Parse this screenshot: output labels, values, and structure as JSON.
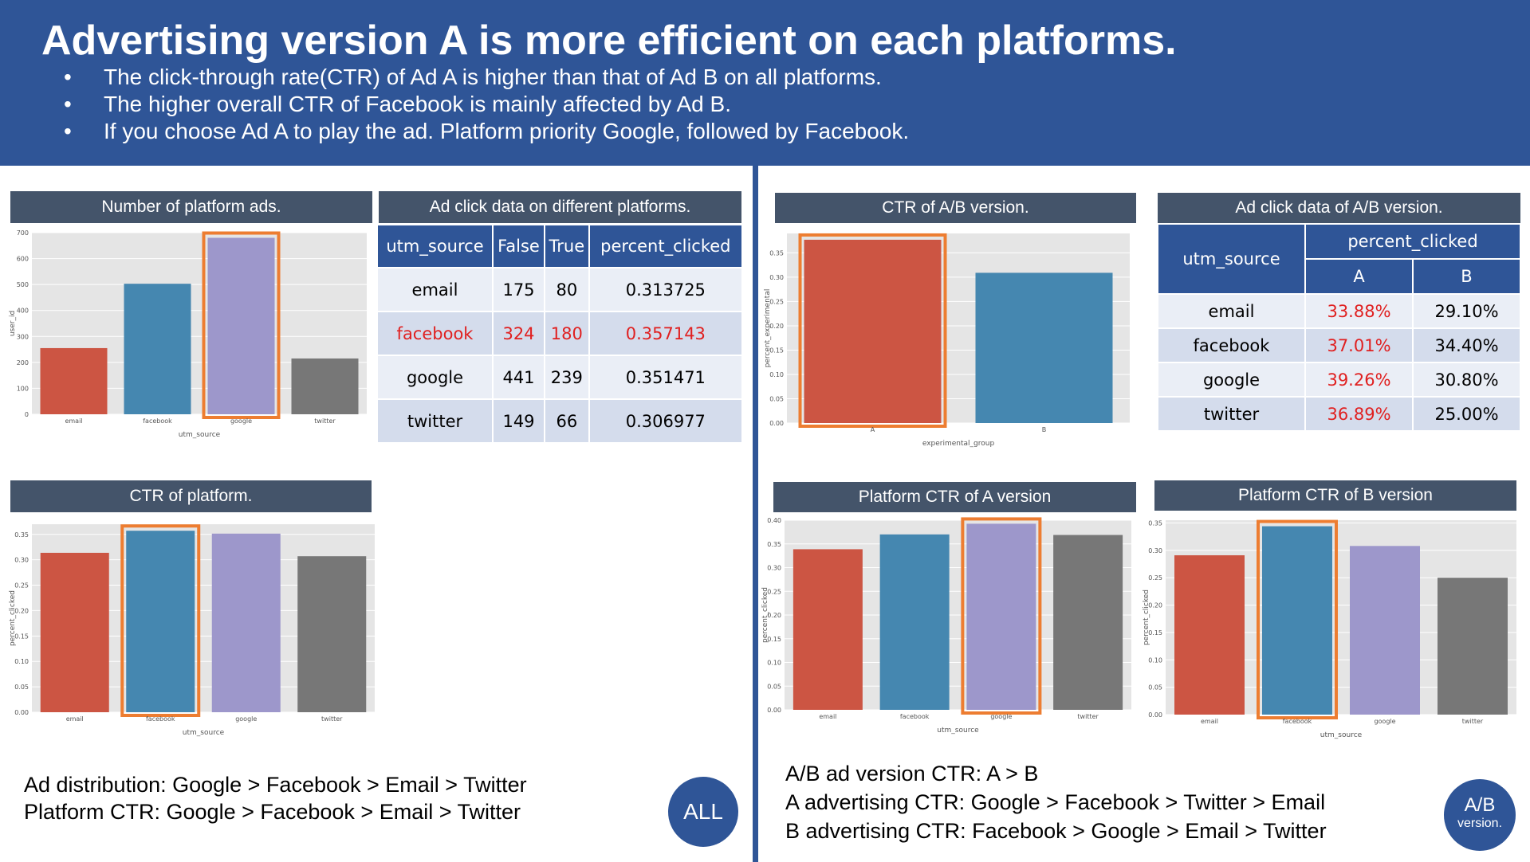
{
  "header": {
    "title": "Advertising version A is more efficient on each platforms.",
    "bullets": [
      "The click-through rate(CTR) of Ad A is higher than that of Ad B on all platforms.",
      "The higher overall CTR of Facebook is mainly affected by Ad B.",
      "If you choose Ad A to play the ad. Platform priority Google, followed by Facebook."
    ],
    "bullet_glyph": "•",
    "bg_color": "#2f5597"
  },
  "panels": {
    "platform_ads_title": "Number of platform ads.",
    "click_data_title": "Ad click data on different platforms.",
    "ctr_platform_title": "CTR of platform.",
    "ctr_ab_title": "CTR of A/B version.",
    "ab_click_title": "Ad click data of A/B version.",
    "platform_a_title": "Platform CTR of A version",
    "platform_b_title": "Platform CTR of B version"
  },
  "table_platform": {
    "headers": [
      "utm_source",
      "False",
      "True",
      "percent_clicked"
    ],
    "rows": [
      {
        "source": "email",
        "false": "175",
        "true": "80",
        "pct": "0.313725",
        "highlight": false
      },
      {
        "source": "facebook",
        "false": "324",
        "true": "180",
        "pct": "0.357143",
        "highlight": true
      },
      {
        "source": "google",
        "false": "441",
        "true": "239",
        "pct": "0.351471",
        "highlight": false
      },
      {
        "source": "twitter",
        "false": "149",
        "true": "66",
        "pct": "0.306977",
        "highlight": false
      }
    ]
  },
  "table_ab": {
    "header_source": "utm_source",
    "header_pct": "percent_clicked",
    "header_a": "A",
    "header_b": "B",
    "rows": [
      {
        "source": "email",
        "a": "33.88%",
        "b": "29.10%"
      },
      {
        "source": "facebook",
        "a": "37.01%",
        "b": "34.40%"
      },
      {
        "source": "google",
        "a": "39.26%",
        "b": "30.80%"
      },
      {
        "source": "twitter",
        "a": "36.89%",
        "b": "25.00%"
      }
    ]
  },
  "notes": {
    "left_line1": "Ad distribution: Google > Facebook > Email > Twitter",
    "left_line2": "Platform CTR: Google > Facebook > Email > Twitter",
    "right_line1": "A/B ad version CTR: A > B",
    "right_line2": "A advertising CTR: Google > Facebook > Twitter > Email",
    "right_line3": "B advertising CTR: Facebook > Google > Email > Twitter"
  },
  "badges": {
    "all": "ALL",
    "ab_top": "A/B",
    "ab_bottom": "version."
  },
  "colors": {
    "email": "#cc5543",
    "facebook": "#4587b0",
    "google": "#9d97cb",
    "twitter": "#777777",
    "highlight_box": "#ed7d31",
    "plot_bg": "#e5e5e5",
    "title_bar": "#44546a",
    "table_header": "#2f5597",
    "red_text": "#e02020"
  },
  "chart_data": [
    {
      "id": "platform_ads",
      "type": "bar",
      "categories": [
        "email",
        "facebook",
        "google",
        "twitter"
      ],
      "values": [
        255,
        503,
        680,
        215
      ],
      "xlabel": "utm_source",
      "ylabel": "user_id",
      "ylim": [
        0,
        700
      ],
      "yticks": [
        0,
        100,
        200,
        300,
        400,
        500,
        600,
        700
      ],
      "highlight": "google",
      "grid": true
    },
    {
      "id": "ctr_platform",
      "type": "bar",
      "categories": [
        "email",
        "facebook",
        "google",
        "twitter"
      ],
      "values": [
        0.313725,
        0.357143,
        0.351471,
        0.306977
      ],
      "xlabel": "utm_source",
      "ylabel": "percent_clicked",
      "ylim": [
        0,
        0.37
      ],
      "yticks": [
        0.0,
        0.05,
        0.1,
        0.15,
        0.2,
        0.25,
        0.3,
        0.35
      ],
      "highlight": "facebook",
      "grid": true
    },
    {
      "id": "ctr_ab",
      "type": "bar",
      "categories": [
        "A",
        "B"
      ],
      "values": [
        0.377,
        0.309
      ],
      "xlabel": "experimental_group",
      "ylabel": "percent_experimental",
      "ylim": [
        0,
        0.39
      ],
      "yticks": [
        0.0,
        0.05,
        0.1,
        0.15,
        0.2,
        0.25,
        0.3,
        0.35
      ],
      "highlight": "A",
      "grid": true
    },
    {
      "id": "platform_a",
      "type": "bar",
      "categories": [
        "email",
        "facebook",
        "google",
        "twitter"
      ],
      "values": [
        0.3388,
        0.3701,
        0.3926,
        0.3689
      ],
      "xlabel": "utm_source",
      "ylabel": "percent_clicked",
      "ylim": [
        0,
        0.4
      ],
      "yticks": [
        0.0,
        0.05,
        0.1,
        0.15,
        0.2,
        0.25,
        0.3,
        0.35,
        0.4
      ],
      "highlight": "google",
      "grid": true
    },
    {
      "id": "platform_b",
      "type": "bar",
      "categories": [
        "email",
        "facebook",
        "google",
        "twitter"
      ],
      "values": [
        0.291,
        0.344,
        0.308,
        0.25
      ],
      "xlabel": "utm_source",
      "ylabel": "percent_clicked",
      "ylim": [
        0,
        0.355
      ],
      "yticks": [
        0.0,
        0.05,
        0.1,
        0.15,
        0.2,
        0.25,
        0.3,
        0.35
      ],
      "highlight": "facebook",
      "grid": true
    }
  ]
}
